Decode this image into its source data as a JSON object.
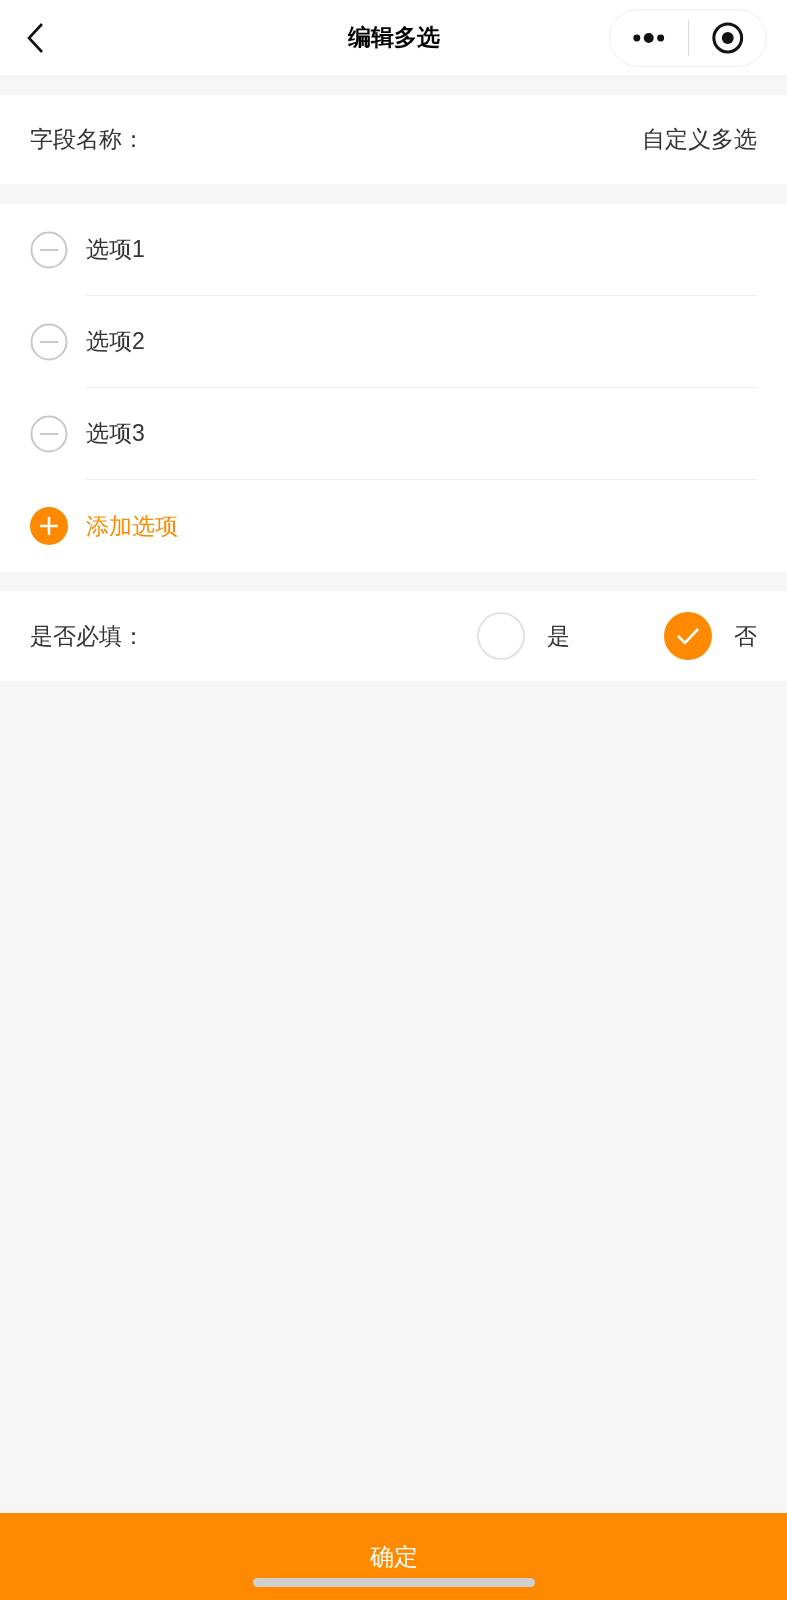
{
  "nav": {
    "title": "编辑多选"
  },
  "field": {
    "label": "字段名称：",
    "value": "自定义多选"
  },
  "options": [
    {
      "label": "选项1"
    },
    {
      "label": "选项2"
    },
    {
      "label": "选项3"
    }
  ],
  "add_option": "添加选项",
  "required": {
    "label": "是否必填：",
    "choices": [
      {
        "label": "是",
        "selected": false
      },
      {
        "label": "否",
        "selected": true
      }
    ]
  },
  "confirm": "确定"
}
